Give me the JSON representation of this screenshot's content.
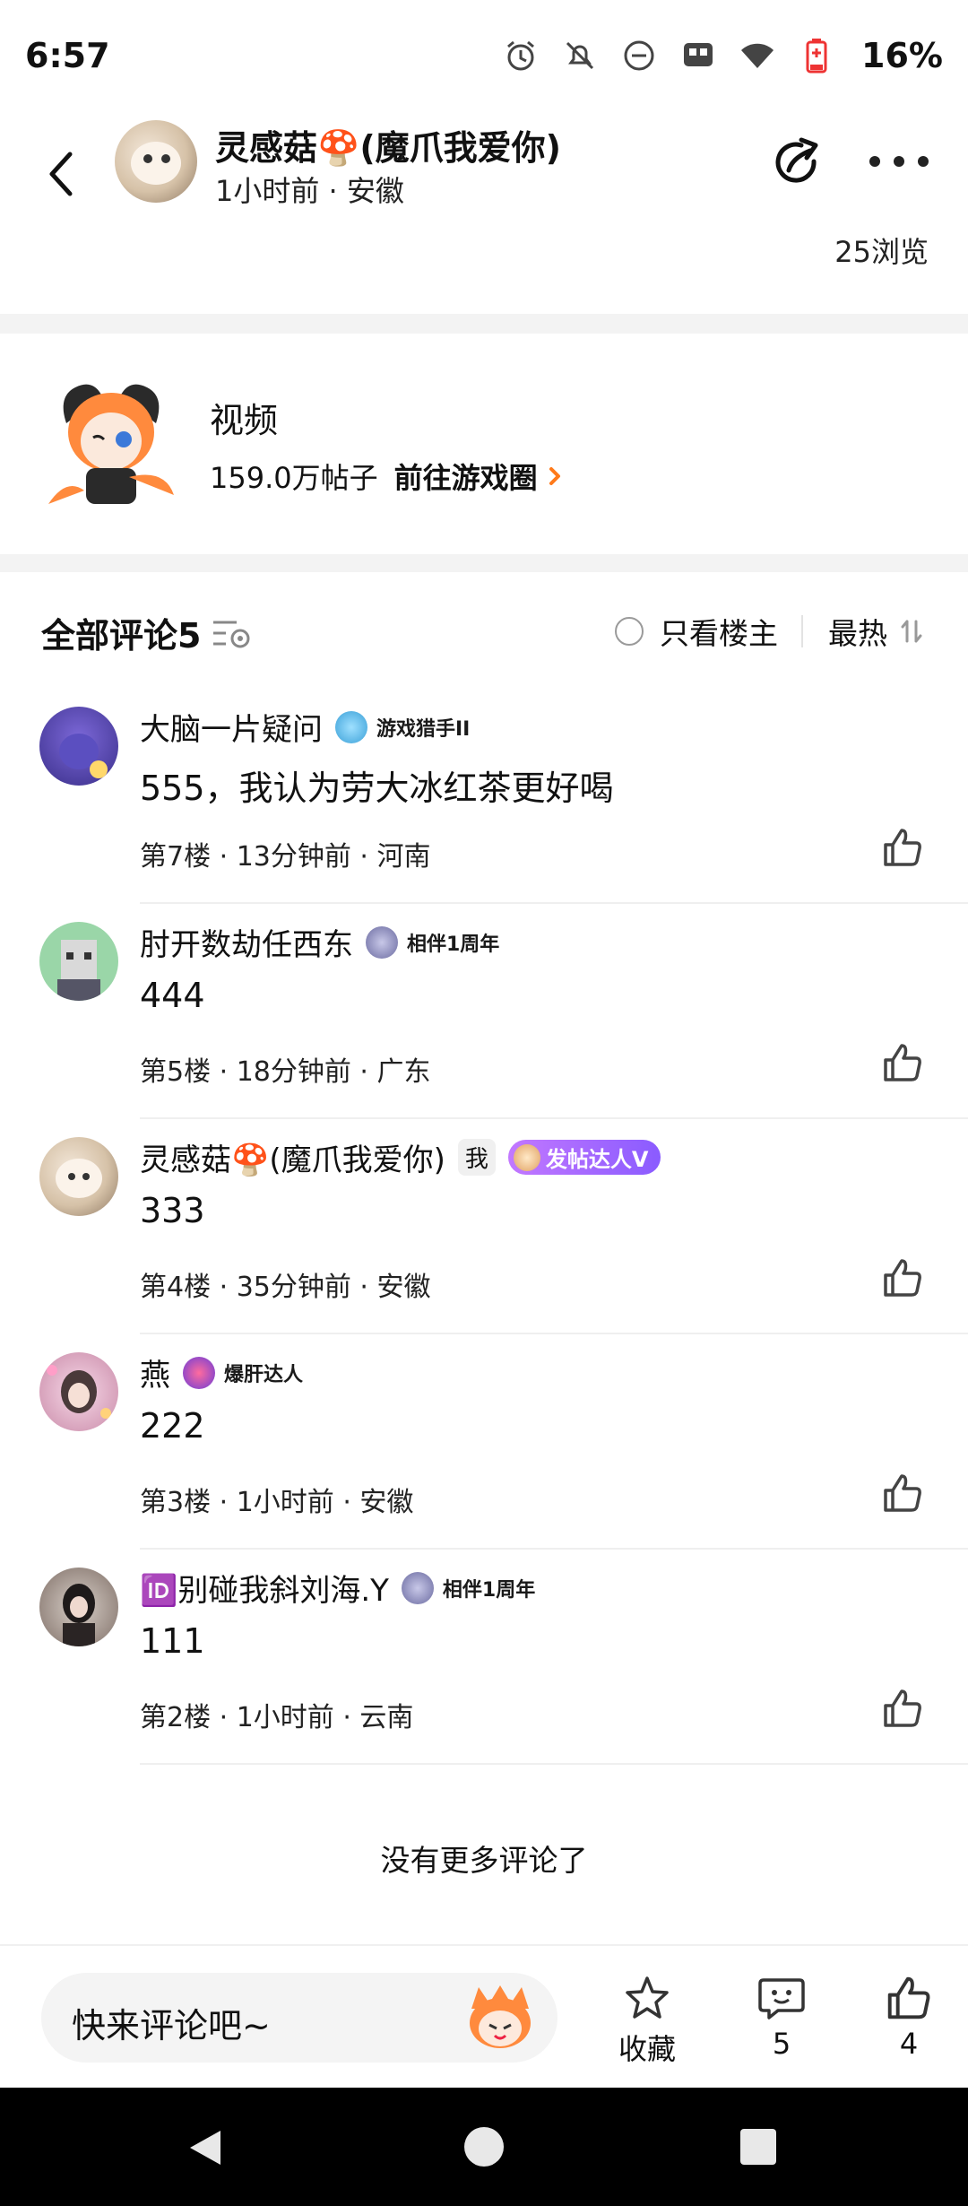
{
  "status_bar": {
    "time": "6:57",
    "battery": "16%",
    "icons": [
      "alarm-icon",
      "bell-off-icon",
      "dnd-icon",
      "app-notification-icon",
      "wifi-icon",
      "battery-icon"
    ]
  },
  "header": {
    "author_name": "灵感菇🍄(魔爪我爱你)",
    "meta": "1小时前 · 安徽",
    "views": "25浏览"
  },
  "circle": {
    "title": "视频",
    "posts": "159.0万帖子",
    "link": "前往游戏圈"
  },
  "comments_section": {
    "title": "全部评论5",
    "only_op": "只看楼主",
    "sort": "最热",
    "items": [
      {
        "name": "大脑一片疑问",
        "badge": "游戏猎手II",
        "text": "555，我认为劳大冰红茶更好喝",
        "meta": "第7楼 · 13分钟前 · 河南"
      },
      {
        "name": "肘开数劫任西东",
        "badge": "相伴1周年",
        "text": "444",
        "meta": "第5楼 · 18分钟前 · 广东"
      },
      {
        "name": "灵感菇🍄(魔爪我爱你)",
        "badge_me": "我",
        "badge": "发帖达人V",
        "text": "333",
        "meta": "第4楼 · 35分钟前 · 安徽"
      },
      {
        "name": "燕",
        "badge": "爆肝达人",
        "text": "222",
        "meta": "第3楼 · 1小时前 · 安徽"
      },
      {
        "name": "🆔别碰我斜刘海.Y",
        "badge": "相伴1周年",
        "text": "111",
        "meta": "第2楼 · 1小时前 · 云南"
      }
    ],
    "no_more": "没有更多评论了"
  },
  "bottom_bar": {
    "placeholder": "快来评论吧~",
    "favorite_label": "收藏",
    "comment_count": "5",
    "like_count": "4"
  },
  "colors": {
    "accent": "#ff7a1a",
    "purple_badge": "#9b5cff",
    "divider": "#efefef",
    "gap": "#f3f3f3"
  }
}
